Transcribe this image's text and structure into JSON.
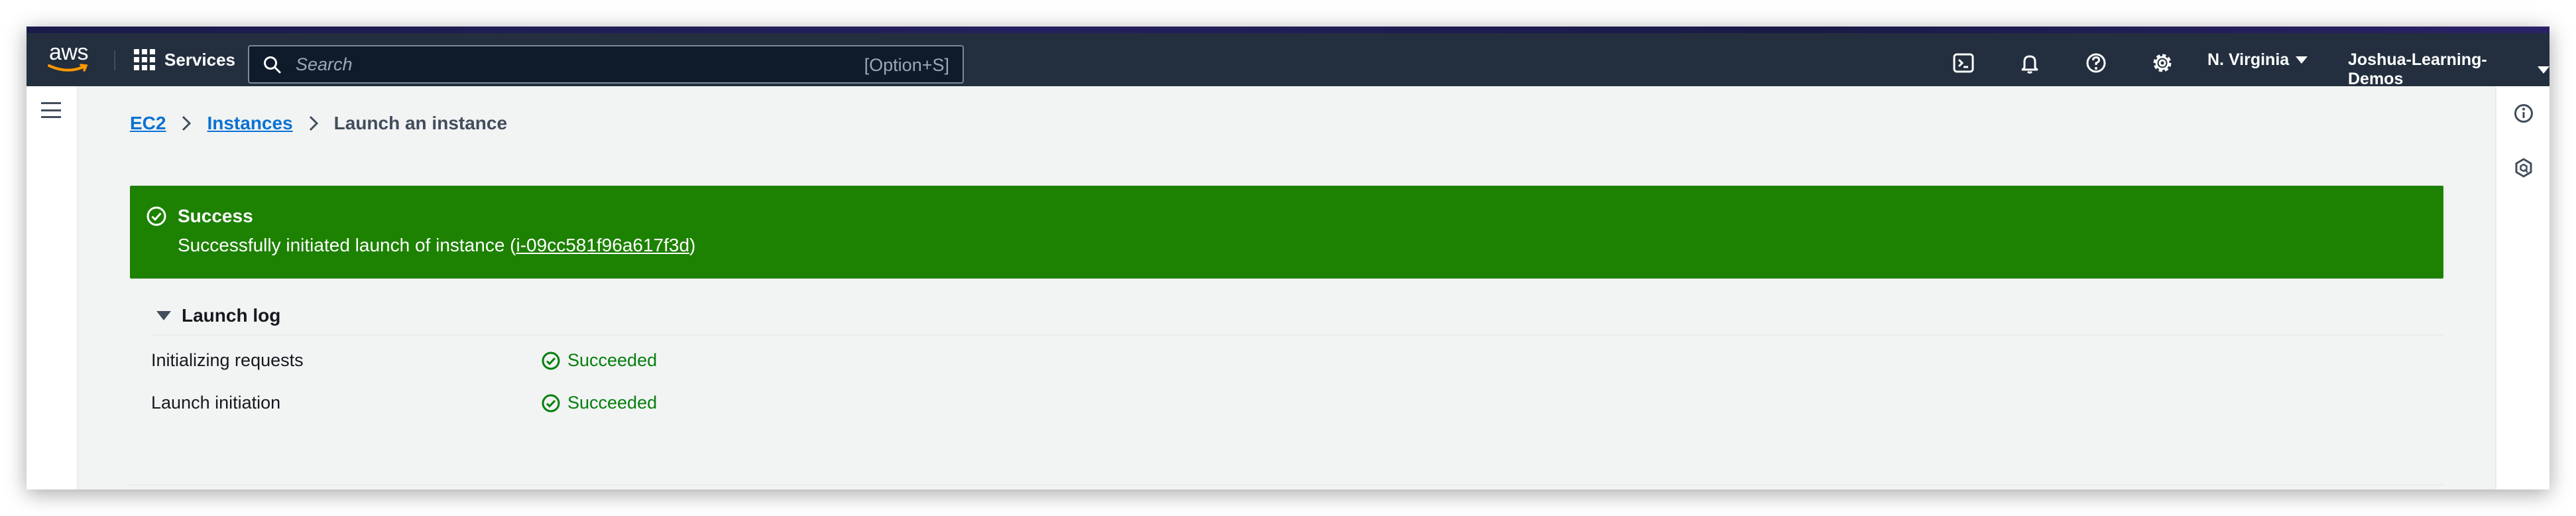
{
  "topbar": {
    "logo_text": "aws",
    "services_label": "Services",
    "search": {
      "placeholder": "Search",
      "shortcut": "[Option+S]"
    },
    "icons": [
      "cloudshell-icon",
      "bell-icon",
      "help-icon",
      "gear-icon"
    ],
    "region_label": "N. Virginia",
    "account_label": "Joshua-Learning-Demos"
  },
  "breadcrumb": {
    "items": [
      "EC2",
      "Instances"
    ],
    "current": "Launch an instance"
  },
  "flash": {
    "title": "Success",
    "message_prefix": "Successfully initiated launch of instance (",
    "instance_id": "i-09cc581f96a617f3d",
    "message_suffix": ")",
    "color": "#1d8102"
  },
  "launch_log": {
    "title": "Launch log",
    "rows": [
      {
        "label": "Initializing requests",
        "status": "Succeeded"
      },
      {
        "label": "Launch initiation",
        "status": "Succeeded"
      }
    ],
    "status_color": "#037f0c"
  },
  "colors": {
    "topbar": "#232f3e",
    "link": "#0972d3",
    "background": "#f2f3f3"
  }
}
